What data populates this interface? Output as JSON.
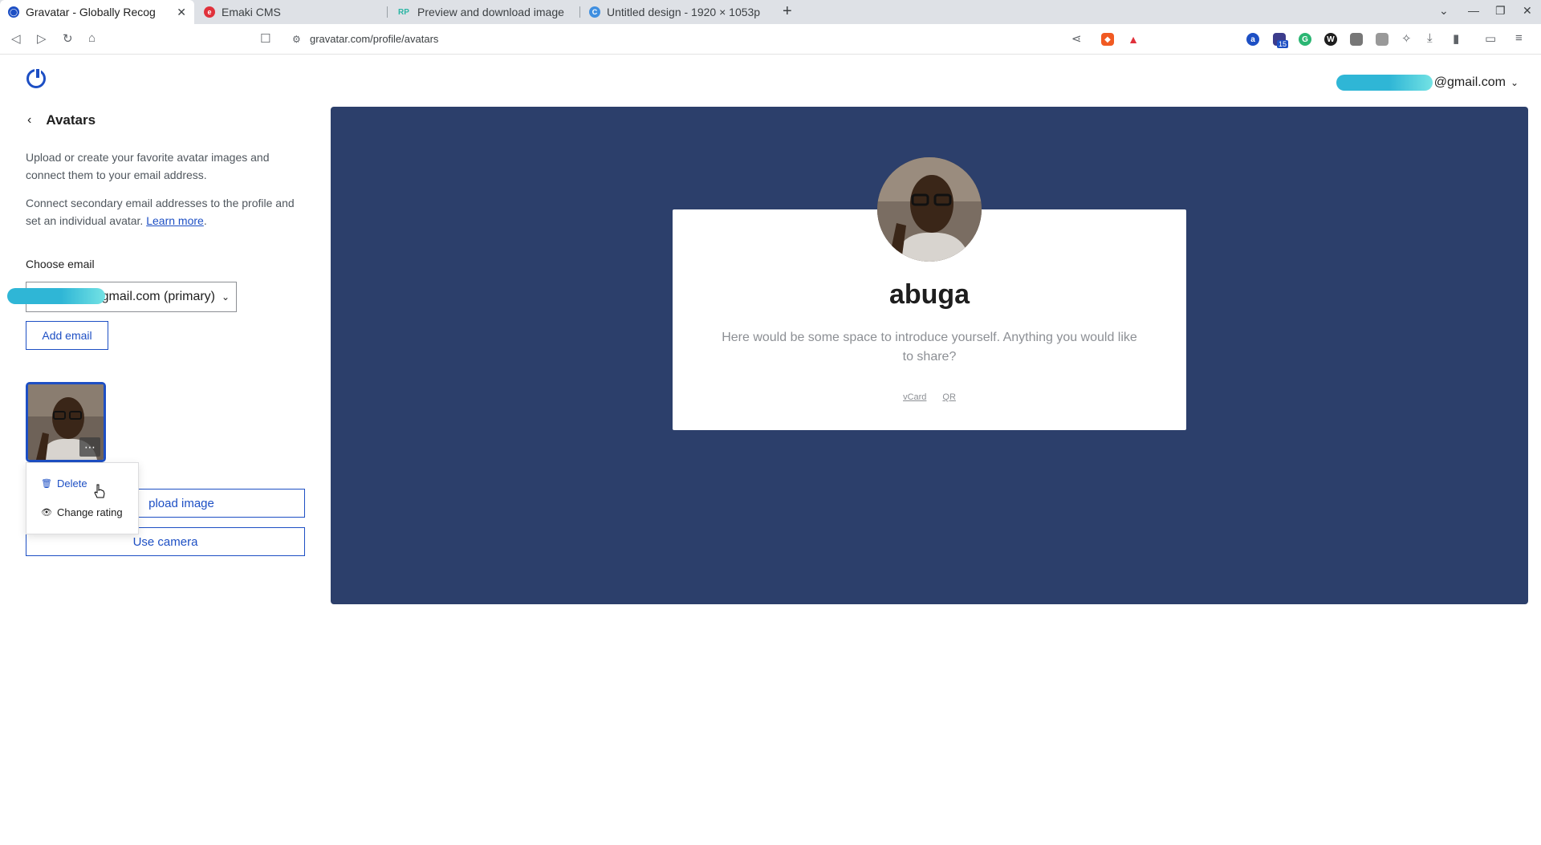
{
  "browser": {
    "tabs": [
      {
        "title": "Gravatar - Globally Recog",
        "favicon": "gravatar-icon",
        "active": true
      },
      {
        "title": "Emaki CMS",
        "favicon": "emaki-icon",
        "active": false
      },
      {
        "title": "Preview and download image",
        "favicon": "rp-icon",
        "active": false
      },
      {
        "title": "Untitled design - 1920 × 1053p",
        "favicon": "canva-icon",
        "active": false
      }
    ],
    "url": "gravatar.com/profile/avatars",
    "extension_badge_count": "15"
  },
  "header": {
    "account_email_suffix": "@gmail.com"
  },
  "sidebar": {
    "title": "Avatars",
    "description_1": "Upload or create your favorite avatar images and connect them to your email address.",
    "description_2_text": "Connect secondary email addresses to the profile and set an individual avatar.",
    "learn_more": "Learn more",
    "period": ".",
    "choose_email_label": "Choose email",
    "selected_email_suffix": "gmail.com (primary)",
    "add_email_button": "Add email",
    "upload_image_button": "pload image",
    "use_camera_button": "Use camera",
    "context_menu": {
      "delete": "Delete",
      "change_rating": "Change rating"
    }
  },
  "preview": {
    "name": "abuga",
    "bio": "Here would be some space to introduce yourself. Anything you would like to share?",
    "links": [
      "vCard",
      "QR"
    ]
  },
  "colors": {
    "accent": "#1d4fc4",
    "preview_background": "#2c3f6b"
  }
}
